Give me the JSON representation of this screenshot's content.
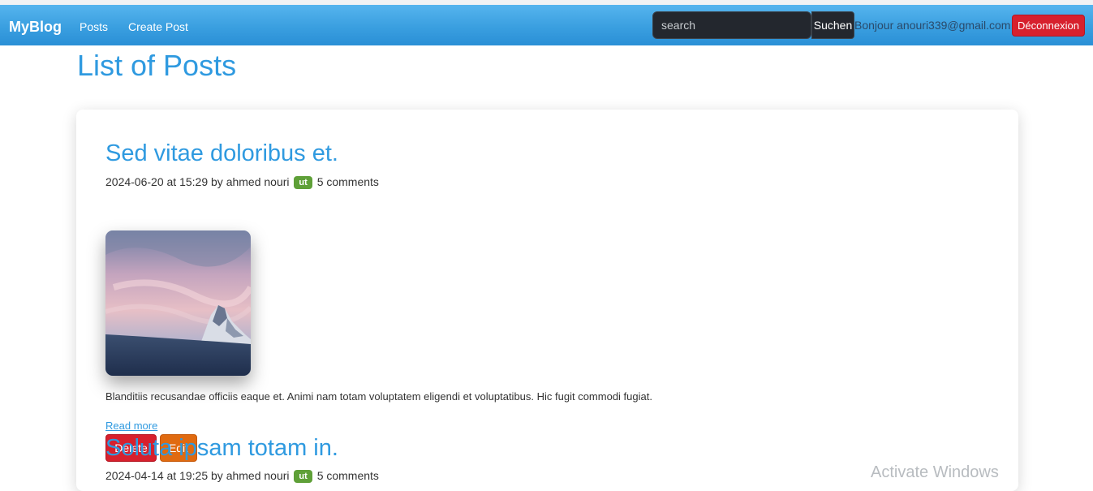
{
  "navbar": {
    "brand": "MyBlog",
    "links": [
      {
        "label": "Posts"
      },
      {
        "label": "Create Post"
      }
    ],
    "search": {
      "placeholder": "search",
      "value": "",
      "button_label": "Suchen"
    },
    "greeting": "Bonjour anouri339@gmail.com",
    "logout_label": "Déconnexion"
  },
  "page": {
    "title": "List of Posts"
  },
  "posts": [
    {
      "title": "Sed vitae doloribus et.",
      "date": "2024-06-20 at 15:29",
      "by": "by",
      "author": "ahmed nouri",
      "tag": "ut",
      "comments": "5 comments",
      "excerpt": "Blanditiis recusandae officiis eaque et. Animi nam totam voluptatem eligendi et voluptatibus. Hic fugit commodi fugiat.",
      "read_more": "Read more",
      "delete_label": "Delete",
      "edit_label": "Edit"
    },
    {
      "title": "Soluta ipsam totam in.",
      "date": "2024-04-14 at 19:25",
      "by": "by",
      "author": "ahmed nouri",
      "tag": "ut",
      "comments": "5 comments"
    }
  ],
  "overlay": {
    "watermark": "Activate Windows"
  },
  "colors": {
    "navbar": "#3a9fe0",
    "accent": "#2f9ae0",
    "danger": "#d7202d",
    "warning": "#e06a10",
    "tag": "#5fa038"
  }
}
